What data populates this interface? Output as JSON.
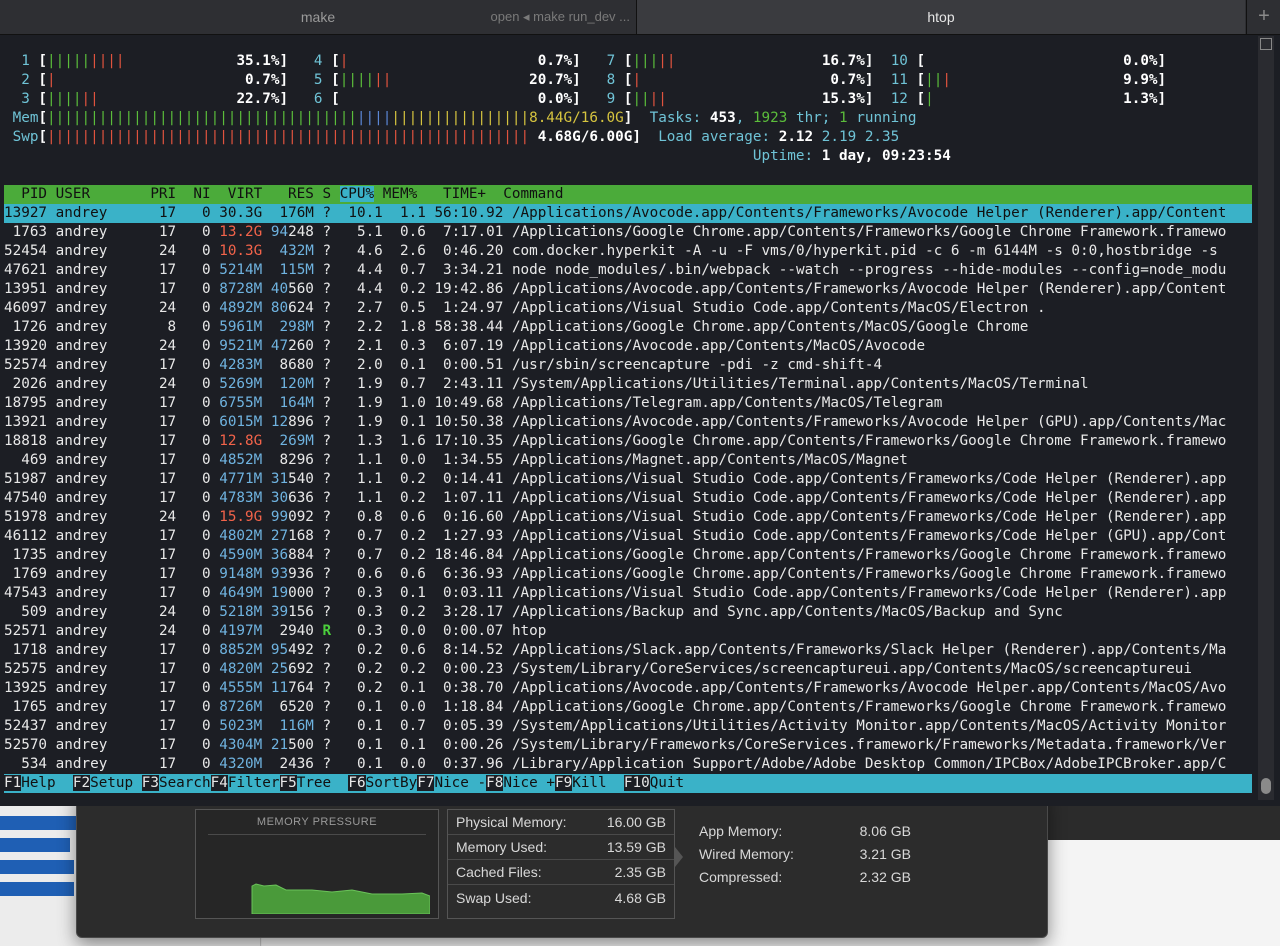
{
  "tabs": [
    {
      "name": "make",
      "subtitle": "open ◂ make run_dev ..."
    },
    {
      "name": "htop"
    }
  ],
  "new_tab_glyph": "+",
  "meters": {
    "cpus": [
      {
        "label": "1",
        "value": "35.1%]"
      },
      {
        "label": "2",
        "value": "0.7%]"
      },
      {
        "label": "3",
        "value": "22.7%]"
      },
      {
        "label": "4",
        "value": "0.7%]"
      },
      {
        "label": "5",
        "value": "20.7%]"
      },
      {
        "label": "6",
        "value": "0.0%]"
      },
      {
        "label": "7",
        "value": "16.7%]"
      },
      {
        "label": "8",
        "value": "0.7%]"
      },
      {
        "label": "9",
        "value": "15.3%]"
      },
      {
        "label": "10",
        "value": "0.0%]"
      },
      {
        "label": "11",
        "value": "9.9%]"
      },
      {
        "label": "12",
        "value": "1.3%]"
      }
    ],
    "mem": {
      "label": "Mem",
      "value": "8.44G/16.0G]"
    },
    "swp": {
      "label": "Swp",
      "value": "4.68G/6.00G]"
    },
    "tasks_label": "Tasks: ",
    "tasks": "453",
    "thr": "1923",
    "thr_label": " thr; ",
    "running": "1",
    "running_label": " running",
    "load_label": "Load average: ",
    "load1": "2.12",
    "load5": "2.19",
    "load15": "2.35",
    "uptime_label": "Uptime: ",
    "uptime": "1 day, 09:23:54"
  },
  "columns": {
    "pre": "  PID USER       PRI  NI  VIRT   RES S ",
    "sorted": "CPU%",
    "post": " MEM%   TIME+  Command"
  },
  "processes": [
    {
      "pid": "13927",
      "user": "andrey",
      "pri": "17",
      "ni": "0",
      "virt": "30.3G",
      "vc": "n",
      "res": "176M",
      "s": "?",
      "cpu": "10.1",
      "mem": "1.1",
      "time": "56:10.92",
      "cmd": "/Applications/Avocode.app/Contents/Frameworks/Avocode Helper (Renderer).app/Content"
    },
    {
      "pid": "1763",
      "user": "andrey",
      "pri": "17",
      "ni": "0",
      "virt": "13.2G",
      "vc": "r",
      "res": "94248",
      "s": "?",
      "cpu": "5.1",
      "mem": "0.6",
      "time": "7:17.01",
      "cmd": "/Applications/Google Chrome.app/Contents/Frameworks/Google Chrome Framework.framewo"
    },
    {
      "pid": "52454",
      "user": "andrey",
      "pri": "24",
      "ni": "0",
      "virt": "10.3G",
      "vc": "r",
      "res": "432M",
      "s": "?",
      "cpu": "4.6",
      "mem": "2.6",
      "time": "0:46.20",
      "cmd": "com.docker.hyperkit -A -u -F vms/0/hyperkit.pid -c 6 -m 6144M -s 0:0,hostbridge -s"
    },
    {
      "pid": "47621",
      "user": "andrey",
      "pri": "17",
      "ni": "0",
      "virt": "5214M",
      "vc": "c",
      "res": "115M",
      "s": "?",
      "cpu": "4.4",
      "mem": "0.7",
      "time": "3:34.21",
      "cmd": "node node_modules/.bin/webpack --watch --progress --hide-modules --config=node_modu"
    },
    {
      "pid": "13951",
      "user": "andrey",
      "pri": "17",
      "ni": "0",
      "virt": "8728M",
      "vc": "c",
      "res": "40560",
      "s": "?",
      "cpu": "4.4",
      "mem": "0.2",
      "time": "19:42.86",
      "cmd": "/Applications/Avocode.app/Contents/Frameworks/Avocode Helper (Renderer).app/Content"
    },
    {
      "pid": "46097",
      "user": "andrey",
      "pri": "24",
      "ni": "0",
      "virt": "4892M",
      "vc": "c",
      "res": "80624",
      "s": "?",
      "cpu": "2.7",
      "mem": "0.5",
      "time": "1:24.97",
      "cmd": "/Applications/Visual Studio Code.app/Contents/MacOS/Electron ."
    },
    {
      "pid": "1726",
      "user": "andrey",
      "pri": "8",
      "ni": "0",
      "virt": "5961M",
      "vc": "c",
      "res": "298M",
      "s": "?",
      "cpu": "2.2",
      "mem": "1.8",
      "time": "58:38.44",
      "cmd": "/Applications/Google Chrome.app/Contents/MacOS/Google Chrome"
    },
    {
      "pid": "13920",
      "user": "andrey",
      "pri": "24",
      "ni": "0",
      "virt": "9521M",
      "vc": "c",
      "res": "47260",
      "s": "?",
      "cpu": "2.1",
      "mem": "0.3",
      "time": "6:07.19",
      "cmd": "/Applications/Avocode.app/Contents/MacOS/Avocode"
    },
    {
      "pid": "52574",
      "user": "andrey",
      "pri": "17",
      "ni": "0",
      "virt": "4283M",
      "vc": "c",
      "res": "8680",
      "s": "?",
      "cpu": "2.0",
      "mem": "0.1",
      "time": "0:00.51",
      "cmd": "/usr/sbin/screencapture -pdi -z cmd-shift-4"
    },
    {
      "pid": "2026",
      "user": "andrey",
      "pri": "24",
      "ni": "0",
      "virt": "5269M",
      "vc": "c",
      "res": "120M",
      "s": "?",
      "cpu": "1.9",
      "mem": "0.7",
      "time": "2:43.11",
      "cmd": "/System/Applications/Utilities/Terminal.app/Contents/MacOS/Terminal"
    },
    {
      "pid": "18795",
      "user": "andrey",
      "pri": "17",
      "ni": "0",
      "virt": "6755M",
      "vc": "c",
      "res": "164M",
      "s": "?",
      "cpu": "1.9",
      "mem": "1.0",
      "time": "10:49.68",
      "cmd": "/Applications/Telegram.app/Contents/MacOS/Telegram"
    },
    {
      "pid": "13921",
      "user": "andrey",
      "pri": "17",
      "ni": "0",
      "virt": "6015M",
      "vc": "c",
      "res": "12896",
      "s": "?",
      "cpu": "1.9",
      "mem": "0.1",
      "time": "10:50.38",
      "cmd": "/Applications/Avocode.app/Contents/Frameworks/Avocode Helper (GPU).app/Contents/Mac"
    },
    {
      "pid": "18818",
      "user": "andrey",
      "pri": "17",
      "ni": "0",
      "virt": "12.8G",
      "vc": "r",
      "res": "269M",
      "s": "?",
      "cpu": "1.3",
      "mem": "1.6",
      "time": "17:10.35",
      "cmd": "/Applications/Google Chrome.app/Contents/Frameworks/Google Chrome Framework.framewo"
    },
    {
      "pid": "469",
      "user": "andrey",
      "pri": "17",
      "ni": "0",
      "virt": "4852M",
      "vc": "c",
      "res": "8296",
      "s": "?",
      "cpu": "1.1",
      "mem": "0.0",
      "time": "1:34.55",
      "cmd": "/Applications/Magnet.app/Contents/MacOS/Magnet"
    },
    {
      "pid": "51987",
      "user": "andrey",
      "pri": "17",
      "ni": "0",
      "virt": "4771M",
      "vc": "c",
      "res": "31540",
      "s": "?",
      "cpu": "1.1",
      "mem": "0.2",
      "time": "0:14.41",
      "cmd": "/Applications/Visual Studio Code.app/Contents/Frameworks/Code Helper (Renderer).app"
    },
    {
      "pid": "47540",
      "user": "andrey",
      "pri": "17",
      "ni": "0",
      "virt": "4783M",
      "vc": "c",
      "res": "30636",
      "s": "?",
      "cpu": "1.1",
      "mem": "0.2",
      "time": "1:07.11",
      "cmd": "/Applications/Visual Studio Code.app/Contents/Frameworks/Code Helper (Renderer).app"
    },
    {
      "pid": "51978",
      "user": "andrey",
      "pri": "24",
      "ni": "0",
      "virt": "15.9G",
      "vc": "r",
      "res": "99092",
      "s": "?",
      "cpu": "0.8",
      "mem": "0.6",
      "time": "0:16.60",
      "cmd": "/Applications/Visual Studio Code.app/Contents/Frameworks/Code Helper (Renderer).app"
    },
    {
      "pid": "46112",
      "user": "andrey",
      "pri": "17",
      "ni": "0",
      "virt": "4802M",
      "vc": "c",
      "res": "27168",
      "s": "?",
      "cpu": "0.7",
      "mem": "0.2",
      "time": "1:27.93",
      "cmd": "/Applications/Visual Studio Code.app/Contents/Frameworks/Code Helper (GPU).app/Cont"
    },
    {
      "pid": "1735",
      "user": "andrey",
      "pri": "17",
      "ni": "0",
      "virt": "4590M",
      "vc": "c",
      "res": "36884",
      "s": "?",
      "cpu": "0.7",
      "mem": "0.2",
      "time": "18:46.84",
      "cmd": "/Applications/Google Chrome.app/Contents/Frameworks/Google Chrome Framework.framewo"
    },
    {
      "pid": "1769",
      "user": "andrey",
      "pri": "17",
      "ni": "0",
      "virt": "9148M",
      "vc": "c",
      "res": "93936",
      "s": "?",
      "cpu": "0.6",
      "mem": "0.6",
      "time": "6:36.93",
      "cmd": "/Applications/Google Chrome.app/Contents/Frameworks/Google Chrome Framework.framewo"
    },
    {
      "pid": "47543",
      "user": "andrey",
      "pri": "17",
      "ni": "0",
      "virt": "4649M",
      "vc": "c",
      "res": "19000",
      "s": "?",
      "cpu": "0.3",
      "mem": "0.1",
      "time": "0:03.11",
      "cmd": "/Applications/Visual Studio Code.app/Contents/Frameworks/Code Helper (Renderer).app"
    },
    {
      "pid": "509",
      "user": "andrey",
      "pri": "24",
      "ni": "0",
      "virt": "5218M",
      "vc": "c",
      "res": "39156",
      "s": "?",
      "cpu": "0.3",
      "mem": "0.2",
      "time": "3:28.17",
      "cmd": "/Applications/Backup and Sync.app/Contents/MacOS/Backup and Sync"
    },
    {
      "pid": "52571",
      "user": "andrey",
      "pri": "24",
      "ni": "0",
      "virt": "4197M",
      "vc": "c",
      "res": "2940",
      "s": "R",
      "cpu": "0.3",
      "mem": "0.0",
      "time": "0:00.07",
      "cmd": "htop"
    },
    {
      "pid": "1718",
      "user": "andrey",
      "pri": "17",
      "ni": "0",
      "virt": "8852M",
      "vc": "c",
      "res": "95492",
      "s": "?",
      "cpu": "0.2",
      "mem": "0.6",
      "time": "8:14.52",
      "cmd": "/Applications/Slack.app/Contents/Frameworks/Slack Helper (Renderer).app/Contents/Ma"
    },
    {
      "pid": "52575",
      "user": "andrey",
      "pri": "17",
      "ni": "0",
      "virt": "4820M",
      "vc": "c",
      "res": "25692",
      "s": "?",
      "cpu": "0.2",
      "mem": "0.2",
      "time": "0:00.23",
      "cmd": "/System/Library/CoreServices/screencaptureui.app/Contents/MacOS/screencaptureui"
    },
    {
      "pid": "13925",
      "user": "andrey",
      "pri": "17",
      "ni": "0",
      "virt": "4555M",
      "vc": "c",
      "res": "11764",
      "s": "?",
      "cpu": "0.2",
      "mem": "0.1",
      "time": "0:38.70",
      "cmd": "/Applications/Avocode.app/Contents/Frameworks/Avocode Helper.app/Contents/MacOS/Avo"
    },
    {
      "pid": "1765",
      "user": "andrey",
      "pri": "17",
      "ni": "0",
      "virt": "8726M",
      "vc": "c",
      "res": "6520",
      "s": "?",
      "cpu": "0.1",
      "mem": "0.0",
      "time": "1:18.84",
      "cmd": "/Applications/Google Chrome.app/Contents/Frameworks/Google Chrome Framework.framewo"
    },
    {
      "pid": "52437",
      "user": "andrey",
      "pri": "17",
      "ni": "0",
      "virt": "5023M",
      "vc": "c",
      "res": "116M",
      "s": "?",
      "cpu": "0.1",
      "mem": "0.7",
      "time": "0:05.39",
      "cmd": "/System/Applications/Utilities/Activity Monitor.app/Contents/MacOS/Activity Monitor"
    },
    {
      "pid": "52570",
      "user": "andrey",
      "pri": "17",
      "ni": "0",
      "virt": "4304M",
      "vc": "c",
      "res": "21500",
      "s": "?",
      "cpu": "0.1",
      "mem": "0.1",
      "time": "0:00.26",
      "cmd": "/System/Library/Frameworks/CoreServices.framework/Frameworks/Metadata.framework/Ver"
    },
    {
      "pid": "534",
      "user": "andrey",
      "pri": "17",
      "ni": "0",
      "virt": "4320M",
      "vc": "c",
      "res": "2436",
      "s": "?",
      "cpu": "0.1",
      "mem": "0.0",
      "time": "0:37.96",
      "cmd": "/Library/Application Support/Adobe/Adobe Desktop Common/IPCBox/AdobeIPCBroker.app/C"
    }
  ],
  "fkeys": [
    {
      "key": "F1",
      "label": "Help  "
    },
    {
      "key": "F2",
      "label": "Setup "
    },
    {
      "key": "F3",
      "label": "Search"
    },
    {
      "key": "F4",
      "label": "Filter"
    },
    {
      "key": "F5",
      "label": "Tree  "
    },
    {
      "key": "F6",
      "label": "SortBy"
    },
    {
      "key": "F7",
      "label": "Nice -"
    },
    {
      "key": "F8",
      "label": "Nice +"
    },
    {
      "key": "F9",
      "label": "Kill  "
    },
    {
      "key": "F10",
      "label": "Quit  "
    }
  ],
  "memory_panel": {
    "pressure_title": "MEMORY PRESSURE",
    "left_stats": [
      {
        "label": "Physical Memory:",
        "value": "16.00 GB"
      },
      {
        "label": "Memory Used:",
        "value": "13.59 GB"
      },
      {
        "label": "Cached Files:",
        "value": "2.35 GB"
      },
      {
        "label": "Swap Used:",
        "value": "4.68 GB"
      }
    ],
    "right_stats": [
      {
        "label": "App Memory:",
        "value": "8.06 GB"
      },
      {
        "label": "Wired Memory:",
        "value": "3.21 GB"
      },
      {
        "label": "Compressed:",
        "value": "2.32 GB"
      }
    ],
    "pressure_color": "#4a9a3a"
  },
  "colors": {
    "header_green": "#4bab3a",
    "selection_cyan": "#3ab2c8",
    "high_virt": "#f2634a"
  }
}
